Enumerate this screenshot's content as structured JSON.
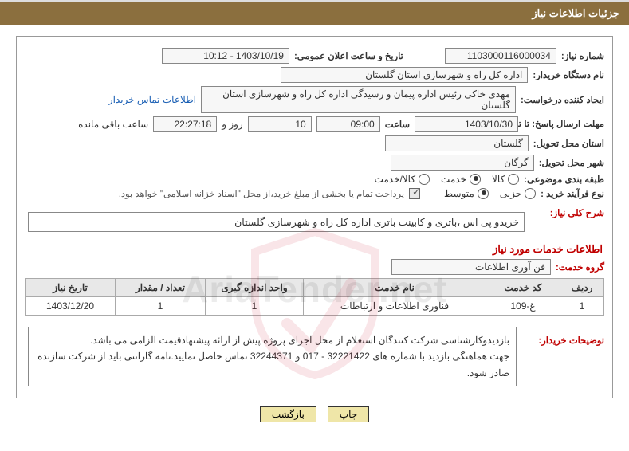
{
  "header": {
    "title": "جزئیات اطلاعات نیاز"
  },
  "fields": {
    "need_no_label": "شماره نیاز:",
    "need_no": "1103000116000034",
    "announce_dt_label": "تاریخ و ساعت اعلان عمومی:",
    "announce_dt": "1403/10/19 - 10:12",
    "buyer_org_label": "نام دستگاه خریدار:",
    "buyer_org": "اداره کل راه و شهرسازی استان گلستان",
    "requester_label": "ایجاد کننده درخواست:",
    "requester": "مهدی خاکی رئیس اداره پیمان و رسیدگی اداره کل راه و شهرسازی استان گلستان",
    "contact_link": "اطلاعات تماس خریدار",
    "deadline_label": "مهلت ارسال پاسخ: تا تاریخ:",
    "deadline_date": "1403/10/30",
    "time_label": "ساعت",
    "deadline_time": "09:00",
    "days_remaining": "10",
    "days_label": "روز و",
    "time_remaining": "22:27:18",
    "remaining_label": "ساعت باقی مانده",
    "delivery_province_label": "استان محل تحویل:",
    "delivery_province": "گلستان",
    "delivery_city_label": "شهر محل تحویل:",
    "delivery_city": "گرگان",
    "subject_class_label": "طبقه بندی موضوعی:",
    "opt_goods": "کالا",
    "opt_service": "خدمت",
    "opt_goods_service": "کالا/خدمت",
    "purchase_type_label": "نوع فرآیند خرید :",
    "opt_minor": "جزیی",
    "opt_medium": "متوسط",
    "payment_note": "پرداخت تمام یا بخشی از مبلغ خرید،از محل \"اسناد خزانه اسلامی\" خواهد بود.",
    "need_summary_label": "شرح کلی نیاز:",
    "need_summary": "خریدو پی اس ،باتری و کابینت باتری اداره کل راه و شهرسازی گلستان",
    "services_info_title": "اطلاعات خدمات مورد نیاز",
    "service_group_label": "گروه خدمت:",
    "service_group": "فن آوری اطلاعات",
    "buyer_notes_label": "توضیحات خریدار:",
    "buyer_notes_1": "بازدیدوکارشناسی شرکت کنندگان استعلام از محل اجرای پروژه پیش از ارائه پیشنهادقیمت الزامی می باشد.",
    "buyer_notes_2": "جهت هماهنگی بازدید با شماره های 32221422 - 017 و 32244371 تماس حاصل نمایید.نامه گارانتی باید از شرکت سازنده صادر شود."
  },
  "table": {
    "headers": [
      "ردیف",
      "کد خدمت",
      "نام خدمت",
      "واحد اندازه گیری",
      "تعداد / مقدار",
      "تاریخ نیاز"
    ],
    "rows": [
      {
        "idx": "1",
        "code": "غ-109",
        "name": "فناوری اطلاعات و ارتباطات",
        "unit": "1",
        "qty": "1",
        "date": "1403/12/20"
      }
    ]
  },
  "buttons": {
    "print": "چاپ",
    "back": "بازگشت"
  },
  "watermark": "AriaTender.net"
}
